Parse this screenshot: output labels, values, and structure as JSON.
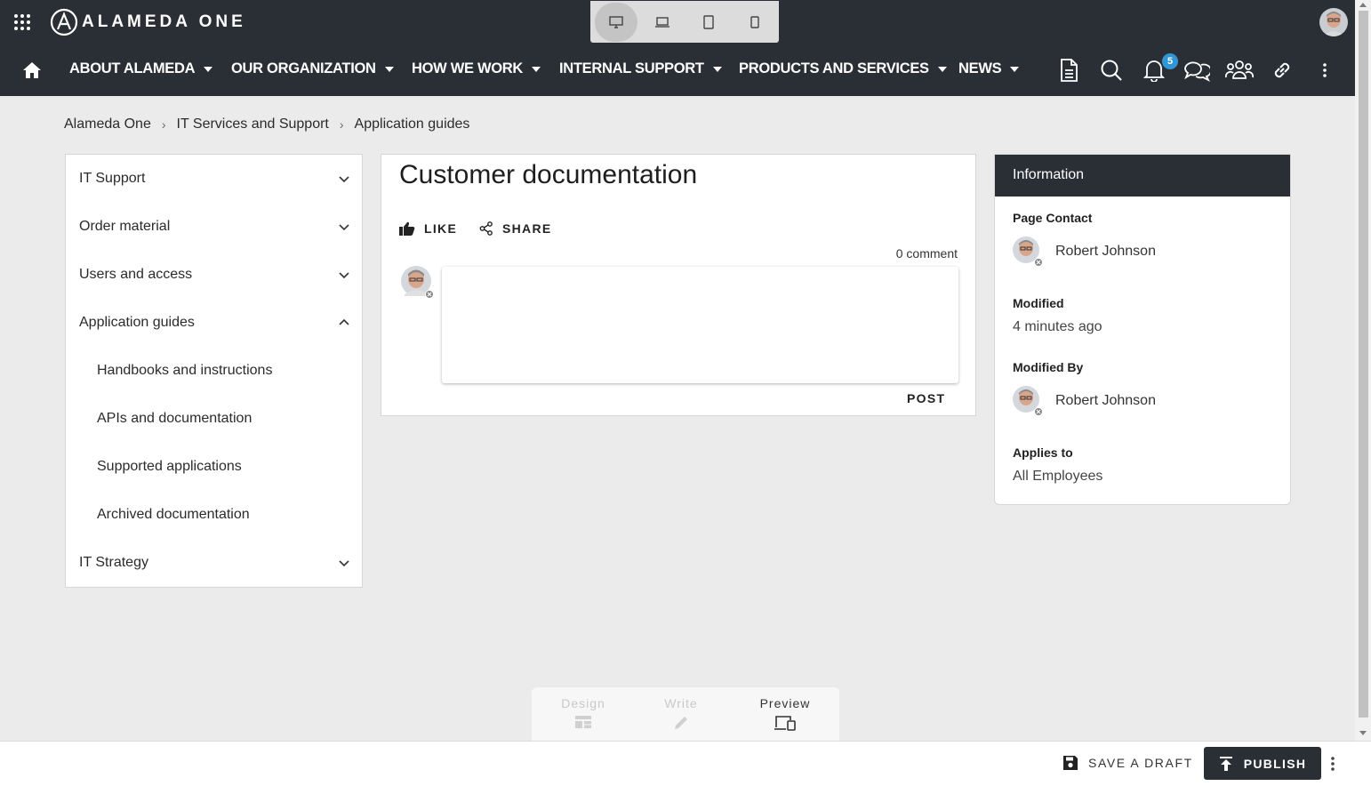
{
  "app": {
    "logo_text": "ALAMEDA ONE"
  },
  "nav": {
    "items": [
      {
        "label": "ABOUT ALAMEDA"
      },
      {
        "label": "OUR ORGANIZATION"
      },
      {
        "label": "HOW WE WORK"
      },
      {
        "label": "INTERNAL SUPPORT"
      },
      {
        "label": "PRODUCTS AND SERVICES"
      },
      {
        "label": "NEWS"
      }
    ],
    "notification_count": "5"
  },
  "breadcrumb": {
    "items": [
      "Alameda One",
      "IT Services and Support",
      "Application guides"
    ],
    "separator": "›"
  },
  "sidebar": {
    "items": [
      {
        "label": "IT Support",
        "expanded": false
      },
      {
        "label": "Order material",
        "expanded": false
      },
      {
        "label": "Users and access",
        "expanded": false
      },
      {
        "label": "Application guides",
        "expanded": true
      },
      {
        "label": "IT Strategy",
        "expanded": false
      }
    ],
    "subitems": [
      {
        "label": "Handbooks and instructions"
      },
      {
        "label": "APIs and documentation"
      },
      {
        "label": "Supported applications"
      },
      {
        "label": "Archived documentation"
      }
    ]
  },
  "page": {
    "title": "Customer documentation",
    "like_label": "LIKE",
    "share_label": "SHARE",
    "comment_count": "0 comment",
    "post_label": "POST"
  },
  "info": {
    "header": "Information",
    "page_contact_label": "Page Contact",
    "page_contact_name": "Robert Johnson",
    "modified_label": "Modified",
    "modified_value": "4 minutes ago",
    "modified_by_label": "Modified By",
    "modified_by_name": "Robert Johnson",
    "applies_label": "Applies to",
    "applies_value": "All Employees"
  },
  "modes": {
    "design": "Design",
    "write": "Write",
    "preview": "Preview",
    "active": "preview"
  },
  "actions": {
    "save_draft": "SAVE A DRAFT",
    "publish": "PUBLISH"
  },
  "colors": {
    "header_bg": "#2a2f36",
    "page_bg": "#ebebeb",
    "badge": "#3196d6"
  }
}
